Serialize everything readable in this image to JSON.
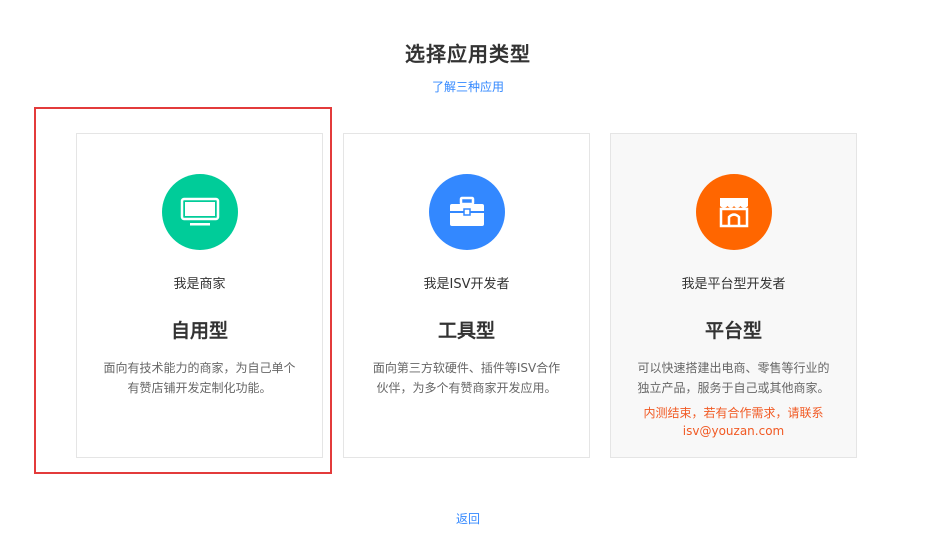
{
  "header": {
    "title": "选择应用类型",
    "learn_link": "了解三种应用"
  },
  "cards": [
    {
      "role": "我是商家",
      "type_name": "自用型",
      "desc_line1": "面向有技术能力的商家，为自己单个",
      "desc_line2": "有赞店铺开发定制化功能。",
      "icon": "monitor-icon",
      "color": "#00cc99",
      "selected": true
    },
    {
      "role": "我是ISV开发者",
      "type_name": "工具型",
      "desc_line1": "面向第三方软硬件、插件等ISV合作",
      "desc_line2": "伙伴，为多个有赞商家开发应用。",
      "icon": "briefcase-icon",
      "color": "#3388ff"
    },
    {
      "role": "我是平台型开发者",
      "type_name": "平台型",
      "desc_line1": "可以快速搭建出电商、零售等行业的",
      "desc_line2": "独立产品，服务于自己或其他商家。",
      "notice_line1": "内测结束，若有合作需求，请联系",
      "notice_line2": "isv@youzan.com",
      "icon": "storefront-icon",
      "color": "#ff6600",
      "disabled": true
    }
  ],
  "footer": {
    "back_link": "返回"
  }
}
